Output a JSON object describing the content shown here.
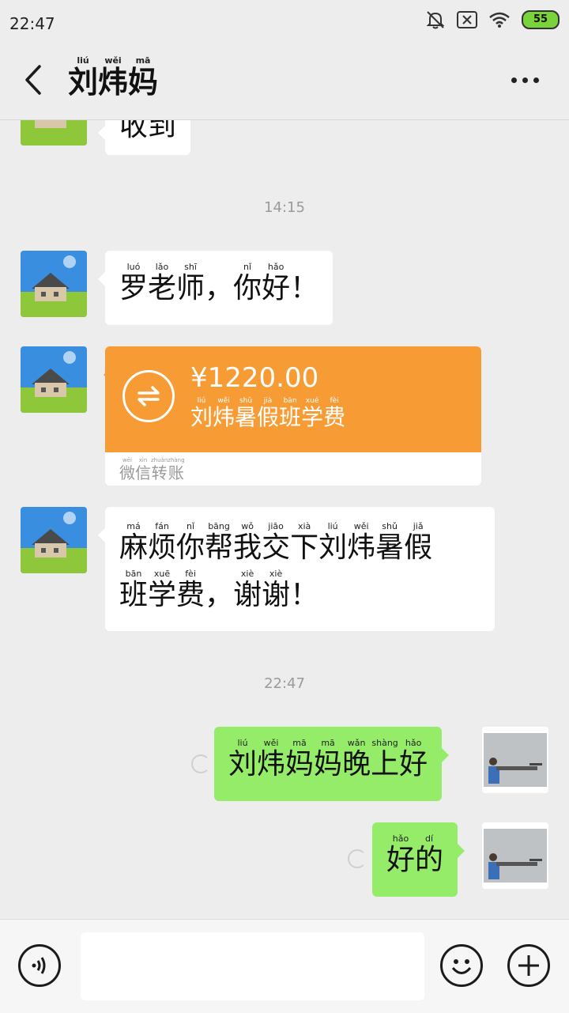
{
  "status_bar": {
    "time": "22:47",
    "battery": "55",
    "icons": [
      "bell-off-icon",
      "sim-error-icon",
      "wifi-icon",
      "battery-icon"
    ]
  },
  "header": {
    "title": [
      {
        "hz": "刘",
        "py": "liú"
      },
      {
        "hz": "炜",
        "py": "wěi"
      },
      {
        "hz": "妈",
        "py": "mā"
      }
    ],
    "back_icon": "chevron-left-icon",
    "more_icon": "more-icon"
  },
  "messages": {
    "partial_top": "收到",
    "time_1": "14:15",
    "greeting": [
      {
        "hz": "罗",
        "py": "luó"
      },
      {
        "hz": "老",
        "py": "lǎo"
      },
      {
        "hz": "师",
        "py": "shī"
      },
      {
        "hz": "，",
        "py": ""
      },
      {
        "hz": "你",
        "py": "nǐ"
      },
      {
        "hz": "好",
        "py": "hǎo"
      },
      {
        "hz": "！",
        "py": ""
      }
    ],
    "transfer": {
      "amount": "¥1220.00",
      "note": [
        {
          "hz": "刘",
          "py": "liú"
        },
        {
          "hz": "炜",
          "py": "wěi"
        },
        {
          "hz": "暑",
          "py": "shǔ"
        },
        {
          "hz": "假",
          "py": "jià"
        },
        {
          "hz": "班",
          "py": "bān"
        },
        {
          "hz": "学",
          "py": "xué"
        },
        {
          "hz": "费",
          "py": "fèi"
        }
      ],
      "label": [
        {
          "hz": "微",
          "py": "wēi"
        },
        {
          "hz": "信",
          "py": "xìn"
        },
        {
          "hz": "转",
          "py": "zhuǎn"
        },
        {
          "hz": "账",
          "py": "zhàng"
        }
      ],
      "color": "#f79c34"
    },
    "request_line1": [
      {
        "hz": "麻",
        "py": "má"
      },
      {
        "hz": "烦",
        "py": "fán"
      },
      {
        "hz": "你",
        "py": "nǐ"
      },
      {
        "hz": "帮",
        "py": "bāng"
      },
      {
        "hz": "我",
        "py": "wǒ"
      },
      {
        "hz": "交",
        "py": "jiāo"
      },
      {
        "hz": "下",
        "py": "xià"
      },
      {
        "hz": "刘",
        "py": "liú"
      },
      {
        "hz": "炜",
        "py": "wěi"
      },
      {
        "hz": "暑",
        "py": "shǔ"
      },
      {
        "hz": "假",
        "py": "jiǎ"
      }
    ],
    "request_line2": [
      {
        "hz": "班",
        "py": "bān"
      },
      {
        "hz": "学",
        "py": "xuē"
      },
      {
        "hz": "费",
        "py": "fèi"
      },
      {
        "hz": "，",
        "py": ""
      },
      {
        "hz": "谢",
        "py": "xiè"
      },
      {
        "hz": "谢",
        "py": "xiè"
      },
      {
        "hz": "！",
        "py": ""
      }
    ],
    "time_2": "22:47",
    "reply_1": [
      {
        "hz": "刘",
        "py": "liú"
      },
      {
        "hz": "炜",
        "py": "wěi"
      },
      {
        "hz": "妈",
        "py": "mā"
      },
      {
        "hz": "妈",
        "py": "mā"
      },
      {
        "hz": "晚",
        "py": "wǎn"
      },
      {
        "hz": "上",
        "py": "shàng"
      },
      {
        "hz": "好",
        "py": "hǎo"
      }
    ],
    "reply_2": [
      {
        "hz": "好",
        "py": "hǎo"
      },
      {
        "hz": "的",
        "py": "dí"
      }
    ]
  },
  "colors": {
    "background": "#ededed",
    "outgoing_bubble": "#95ec69",
    "incoming_bubble": "#ffffff"
  },
  "input_bar": {
    "voice_icon": "voice-icon",
    "emoji_icon": "emoji-icon",
    "plus_icon": "plus-icon"
  }
}
